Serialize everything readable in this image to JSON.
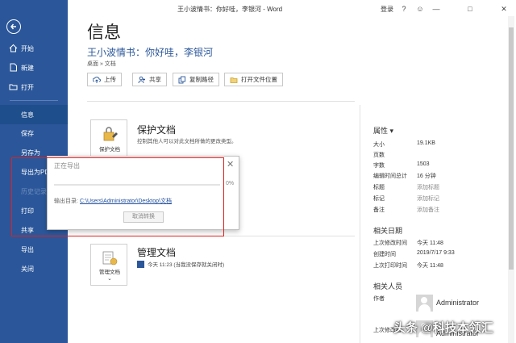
{
  "window": {
    "title": "王小波情书：你好哇，李银河 - Word",
    "signin": "登录",
    "help": "?",
    "minimize": "—",
    "maximize": "□",
    "close": "✕"
  },
  "nav": {
    "items": [
      {
        "label": "开始",
        "icon": "home-icon"
      },
      {
        "label": "新建",
        "icon": "new-doc-icon"
      },
      {
        "label": "打开",
        "icon": "folder-open-icon"
      },
      {
        "label": "信息"
      },
      {
        "label": "保存"
      },
      {
        "label": "另存为"
      },
      {
        "label": "导出为PDF"
      },
      {
        "label": "历史记录"
      },
      {
        "label": "打印"
      },
      {
        "label": "共享"
      },
      {
        "label": "导出"
      },
      {
        "label": "关闭"
      }
    ]
  },
  "main": {
    "page_title": "信息",
    "doc_title": "王小波情书：你好哇，李银河",
    "doc_path": "桌面 » 文档",
    "actions": [
      {
        "label": "上传",
        "icon": "upload-icon"
      },
      {
        "label": "共享",
        "icon": "share-icon"
      },
      {
        "label": "复制路径",
        "icon": "copy-path-icon"
      },
      {
        "label": "打开文件位置",
        "icon": "folder-icon"
      }
    ],
    "protect": {
      "tile_label": "保护文档",
      "heading": "保护文档",
      "description": "控制其他人可以对此文档所做的更改类型。"
    },
    "manage": {
      "tile_label": "管理文档",
      "heading": "管理文档",
      "item": "今天 11:23 (当我没保存就关闭时)"
    }
  },
  "properties": {
    "heading": "属性 ▾",
    "rows": [
      {
        "key": "大小",
        "value": "19.1KB"
      },
      {
        "key": "页数",
        "value": ""
      },
      {
        "key": "字数",
        "value": "1503"
      },
      {
        "key": "编辑时间总计",
        "value": "16 分钟"
      },
      {
        "key": "标题",
        "value": "添加标题",
        "muted": true
      },
      {
        "key": "标记",
        "value": "添加标记",
        "muted": true
      },
      {
        "key": "备注",
        "value": "添加备注",
        "muted": true
      }
    ],
    "dates_heading": "相关日期",
    "dates": [
      {
        "key": "上次修改时间",
        "value": "今天 11:48"
      },
      {
        "key": "创建时间",
        "value": "2019/7/17 9:33"
      },
      {
        "key": "上次打印时间",
        "value": "今天 11:48"
      }
    ],
    "people_heading": "相关人员",
    "author_label": "作者",
    "author_name": "Administrator",
    "last_modified_by_label": "上次修改者",
    "last_modified_by_name": "Administrator"
  },
  "export_dialog": {
    "title": "正在导出",
    "close": "✕",
    "progress_percent": 0,
    "progress_label": "0%",
    "output_label": "输出目录:",
    "output_path": "C:\\Users\\Administrator\\Desktop\\文档",
    "cancel_label": "取消转换"
  },
  "watermark": "头条 @科技本领汇",
  "colors": {
    "nav_bg": "#2b579a",
    "accent": "#2b579a",
    "highlight_box": "#e02020"
  }
}
